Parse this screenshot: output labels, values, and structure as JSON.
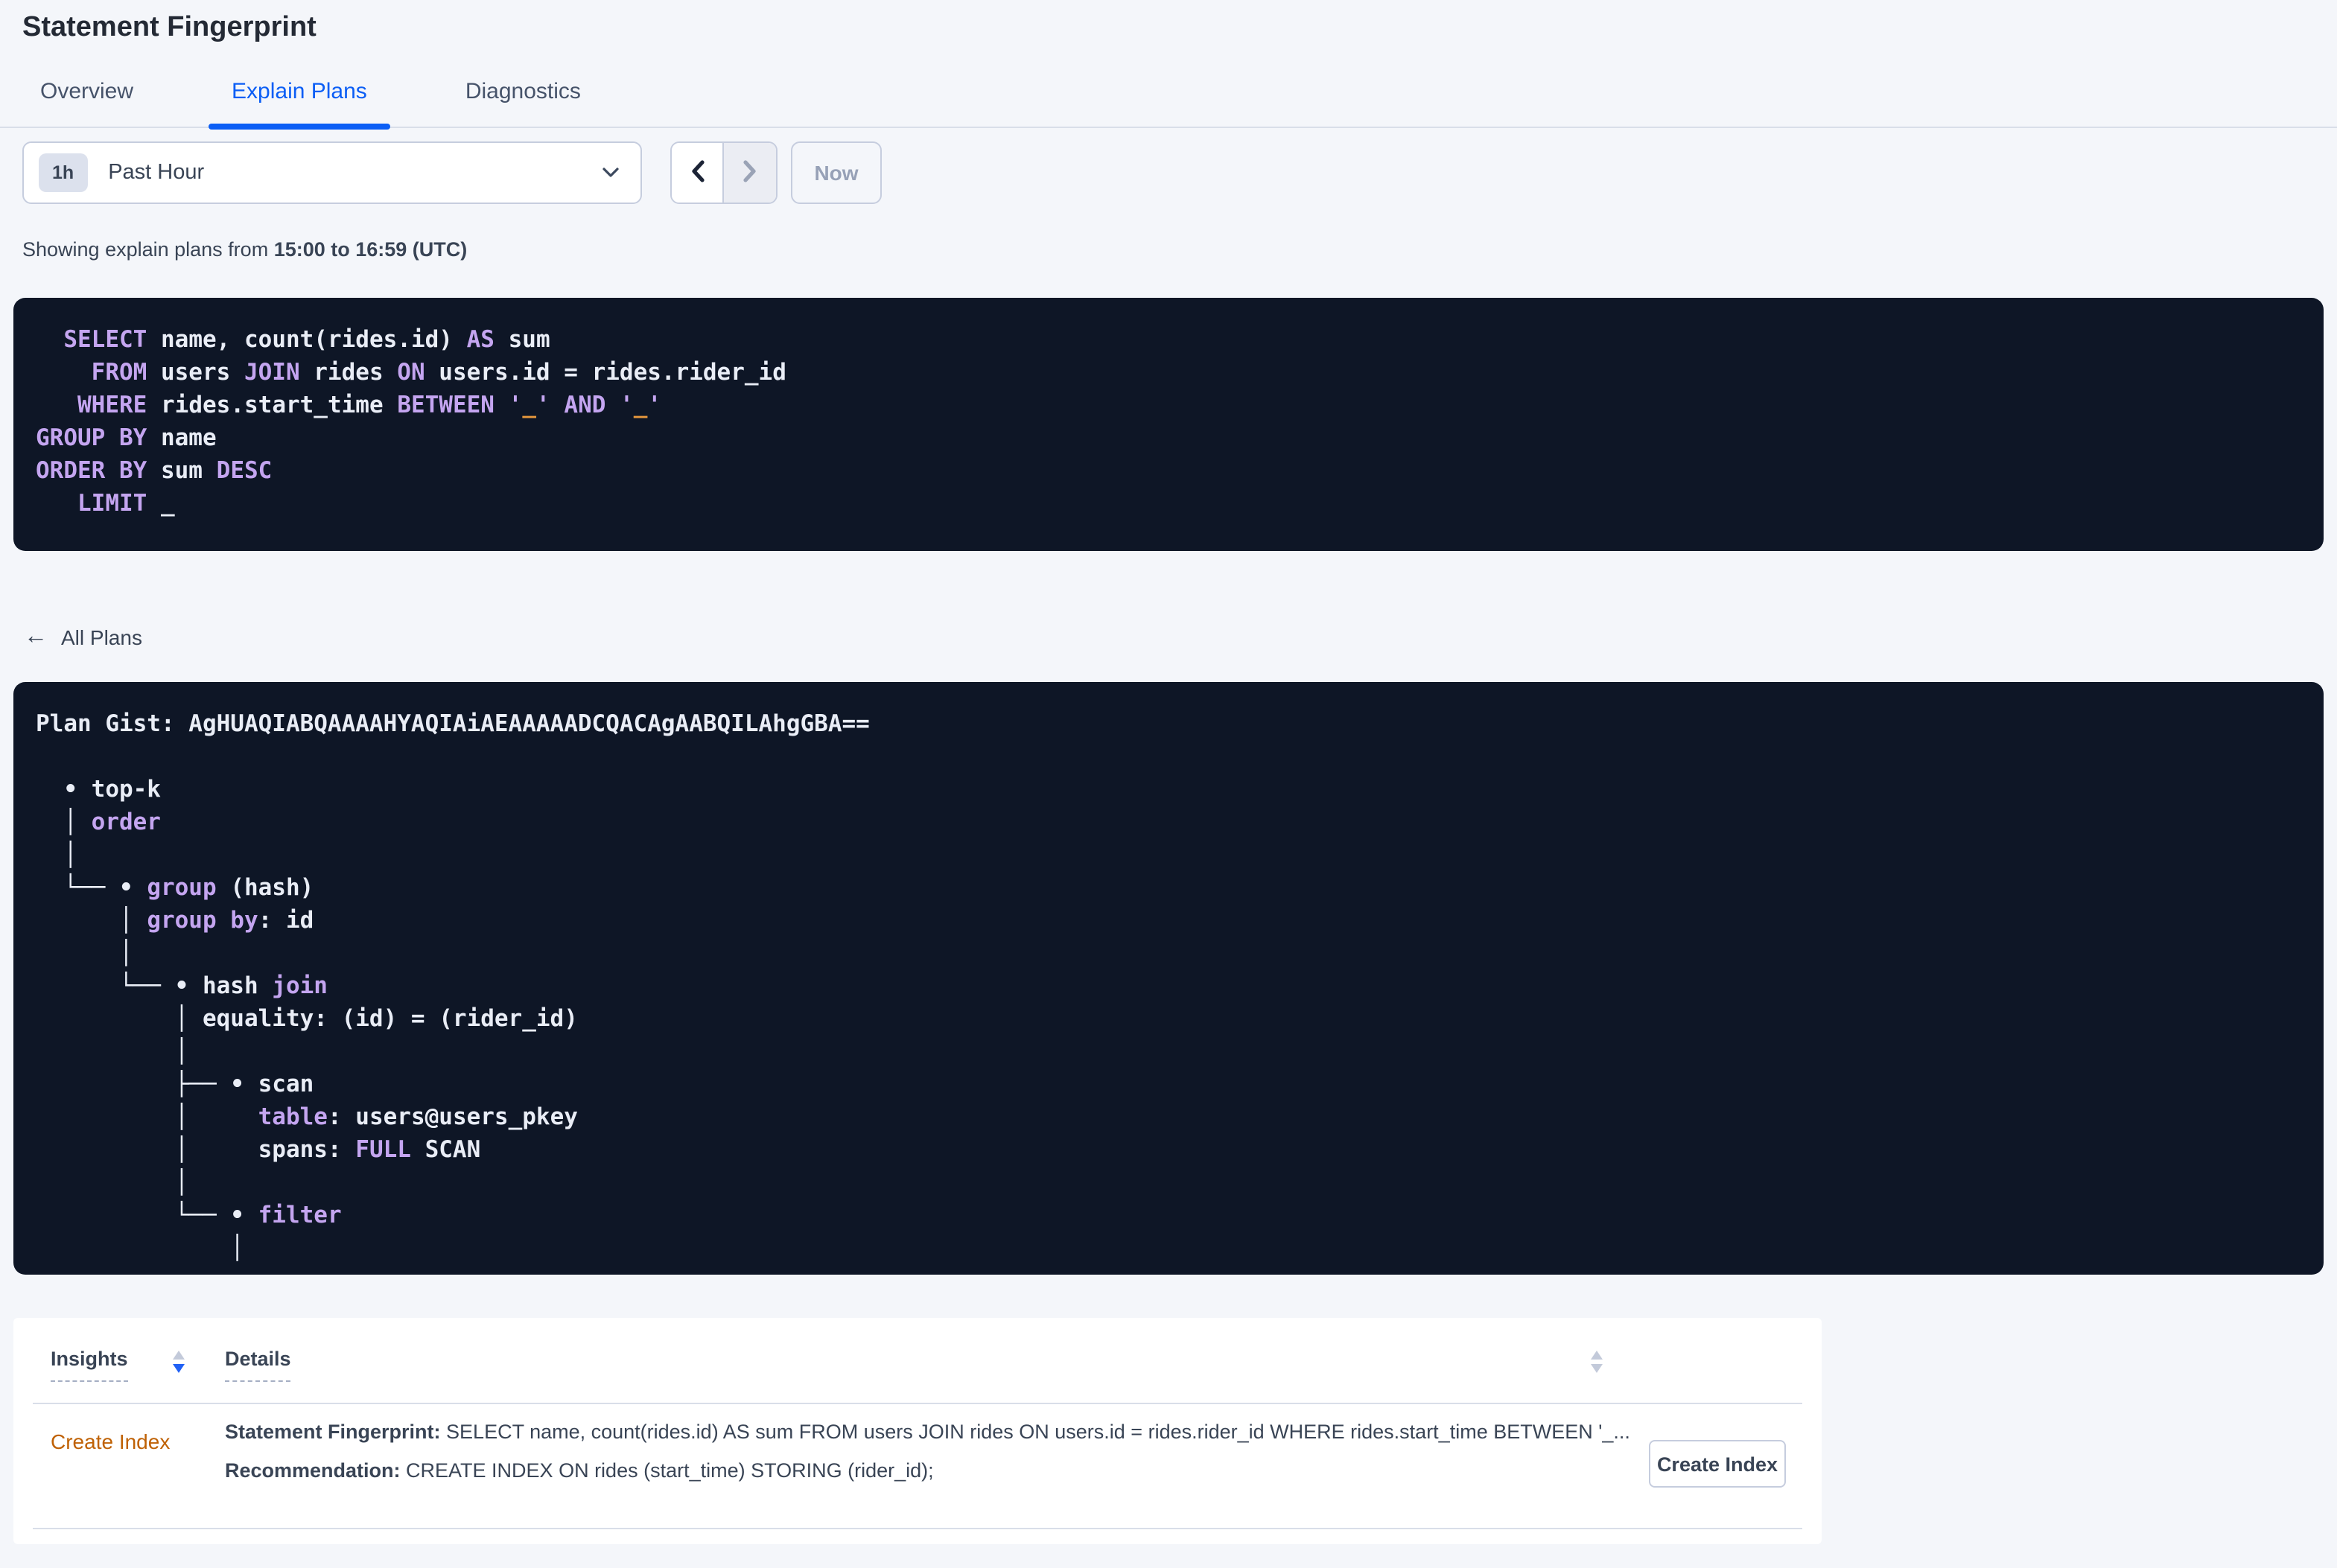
{
  "header": {
    "title": "Statement Fingerprint"
  },
  "tabs": [
    {
      "label": "Overview"
    },
    {
      "label": "Explain Plans"
    },
    {
      "label": "Diagnostics"
    }
  ],
  "active_tab": "Explain Plans",
  "toolbar": {
    "interval_badge": "1h",
    "interval_label": "Past Hour",
    "now_label": "Now"
  },
  "caption": {
    "prefix": "Showing explain plans from ",
    "range": "15:00 to 16:59 (UTC)"
  },
  "sql_lines": [
    [
      {
        "t": "  "
      },
      {
        "t": "SELECT",
        "c": "kw"
      },
      {
        "t": " name, count(rides.id) "
      },
      {
        "t": "AS",
        "c": "kw"
      },
      {
        "t": " sum"
      }
    ],
    [
      {
        "t": "    "
      },
      {
        "t": "FROM",
        "c": "kw"
      },
      {
        "t": " users "
      },
      {
        "t": "JOIN",
        "c": "kw"
      },
      {
        "t": " rides "
      },
      {
        "t": "ON",
        "c": "kw"
      },
      {
        "t": " users.id = rides.rider_id"
      }
    ],
    [
      {
        "t": "   "
      },
      {
        "t": "WHERE",
        "c": "kw"
      },
      {
        "t": " rides.start_time "
      },
      {
        "t": "BETWEEN",
        "c": "kw"
      },
      {
        "t": " "
      },
      {
        "t": "'",
        "c": "kw"
      },
      {
        "t": "_",
        "c": "ph"
      },
      {
        "t": "'",
        "c": "kw"
      },
      {
        "t": " "
      },
      {
        "t": "AND",
        "c": "kw"
      },
      {
        "t": " "
      },
      {
        "t": "'",
        "c": "kw"
      },
      {
        "t": "_",
        "c": "ph"
      },
      {
        "t": "'",
        "c": "kw"
      }
    ],
    [
      {
        "t": "GROUP BY",
        "c": "kw"
      },
      {
        "t": " name"
      }
    ],
    [
      {
        "t": "ORDER BY",
        "c": "kw"
      },
      {
        "t": " sum "
      },
      {
        "t": "DESC",
        "c": "kw"
      }
    ],
    [
      {
        "t": "   "
      },
      {
        "t": "LIMIT",
        "c": "kw"
      },
      {
        "t": " _"
      }
    ]
  ],
  "all_plans_link": {
    "arrow": "←",
    "label": "All Plans"
  },
  "plan": {
    "gist_line": [
      {
        "t": "Plan Gist: AgHUAQIABQAAAAHYAQIAiAEAAAAADCQACAgAABQILAhgGBA=="
      }
    ],
    "tree": [
      [
        {
          "t": "  • top-k"
        }
      ],
      [
        {
          "t": "  │ "
        },
        {
          "t": "order",
          "c": "kw"
        }
      ],
      [
        {
          "t": "  │"
        }
      ],
      [
        {
          "t": "  └── • "
        },
        {
          "t": "group",
          "c": "kw"
        },
        {
          "t": " (hash)"
        }
      ],
      [
        {
          "t": "      │ "
        },
        {
          "t": "group by",
          "c": "kw"
        },
        {
          "t": ": id"
        }
      ],
      [
        {
          "t": "      │"
        }
      ],
      [
        {
          "t": "      └── • hash "
        },
        {
          "t": "join",
          "c": "kw"
        }
      ],
      [
        {
          "t": "          │ equality: (id) = (rider_id)"
        }
      ],
      [
        {
          "t": "          │"
        }
      ],
      [
        {
          "t": "          ├── • scan"
        }
      ],
      [
        {
          "t": "          │     "
        },
        {
          "t": "table",
          "c": "kw"
        },
        {
          "t": ": users@users_pkey"
        }
      ],
      [
        {
          "t": "          │     spans: "
        },
        {
          "t": "FULL",
          "c": "kw"
        },
        {
          "t": " SCAN"
        }
      ],
      [
        {
          "t": "          │"
        }
      ],
      [
        {
          "t": "          └── • "
        },
        {
          "t": "filter",
          "c": "kw"
        }
      ],
      [
        {
          "t": "              │"
        }
      ]
    ]
  },
  "insights": {
    "col_insights": "Insights",
    "col_details": "Details",
    "row": {
      "insight_link": "Create Index",
      "fp_label": "Statement Fingerprint:",
      "fp_text": " SELECT name, count(rides.id) AS sum FROM users JOIN rides ON users.id = rides.rider_id WHERE rides.start_time BETWEEN '_...",
      "rec_label": "Recommendation:",
      "rec_text": " CREATE INDEX ON rides (start_time) STORING (rider_id);",
      "action_label": "Create Index"
    }
  },
  "colors": {
    "accent_blue": "#0b5ef5",
    "keyword_purple": "#c4a5f0",
    "placeholder_orange": "#e8993d",
    "insight_link_orange": "#bf6104",
    "panel_dark": "#0e1626"
  }
}
